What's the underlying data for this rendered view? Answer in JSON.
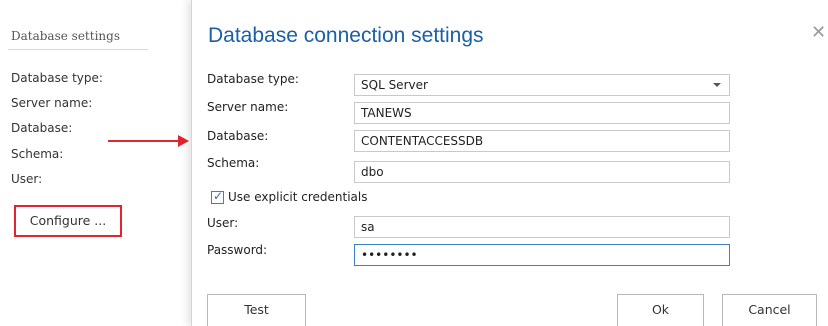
{
  "background": {
    "title": "Database settings",
    "labels": [
      "Database type:",
      "Server name:",
      "Database:",
      "Schema:",
      "User:"
    ],
    "configure_label": "Configure ..."
  },
  "dialog": {
    "title": "Database connection settings",
    "close_icon": "close-icon",
    "fields": {
      "db_type_label": "Database type:",
      "db_type_value": "SQL Server",
      "server_label": "Server name:",
      "server_value": "TANEWS",
      "database_label": "Database:",
      "database_value": "CONTENTACCESSDB",
      "schema_label": "Schema:",
      "schema_value": "dbo",
      "explicit_credentials_label": "Use explicit credentials",
      "explicit_credentials_checked": true,
      "user_label": "User:",
      "user_value": "sa",
      "password_label": "Password:",
      "password_value": "••••••••"
    },
    "buttons": {
      "test": "Test",
      "ok": "Ok",
      "cancel": "Cancel"
    }
  },
  "colors": {
    "accent": "#1a5fa8",
    "highlight": "#e0262c",
    "focus": "#3c7fc4"
  }
}
